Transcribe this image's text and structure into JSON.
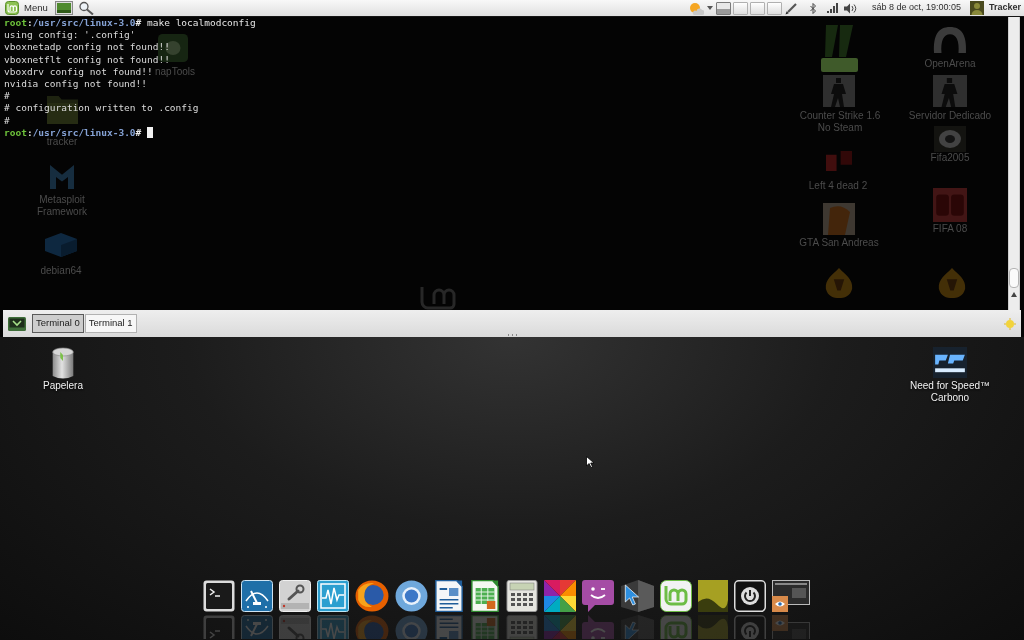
{
  "top_panel": {
    "menu": {
      "label": "Menu"
    },
    "workspaces": [
      {
        "selected": true
      },
      {
        "selected": false
      },
      {
        "selected": false
      },
      {
        "selected": false
      }
    ],
    "clock": "sáb 8 de oct, 19:00:05",
    "user": "Tracker"
  },
  "terminal": {
    "lines": [
      {
        "kind": "prompt",
        "user": "root",
        "separator": ":",
        "path": "/usr/src/linux-3.0",
        "symbol": "#",
        "command": "make localmodconfig"
      },
      {
        "kind": "output",
        "text": "using config: '.config'"
      },
      {
        "kind": "output",
        "text": "vboxnetadp config not found!!"
      },
      {
        "kind": "output",
        "text": "vboxnetflt config not found!!"
      },
      {
        "kind": "output",
        "text": "vboxdrv config not found!!"
      },
      {
        "kind": "output",
        "text": "nvidia config not found!!"
      },
      {
        "kind": "output",
        "text": "#"
      },
      {
        "kind": "output",
        "text": "# configuration written to .config"
      },
      {
        "kind": "output",
        "text": "#"
      },
      {
        "kind": "prompt",
        "user": "root",
        "separator": ":",
        "path": "/usr/src/linux-3.0",
        "symbol": "#"
      }
    ],
    "cursor": true,
    "tabs": [
      {
        "label": "Terminal 0",
        "selected": true
      },
      {
        "label": "Terminal 1",
        "selected": false
      }
    ]
  },
  "desktop": {
    "behind_terminal": [
      {
        "kind": "tile",
        "label_lines": [
          "napTools"
        ],
        "selected": false
      },
      {
        "kind": "folder",
        "label_lines": [
          "tracker"
        ],
        "selected": false
      },
      {
        "kind": "mlogo",
        "label_lines": [
          "Metasploit",
          "Framework"
        ],
        "selected": false
      },
      {
        "kind": "cube",
        "label_lines": [
          "debian64"
        ],
        "selected": false
      },
      {
        "kind": "claw",
        "selected": true
      },
      {
        "kind": "soldier",
        "label_lines": [
          "Counter Strike 1.6",
          "No Steam"
        ],
        "selected": false
      },
      {
        "kind": "digits",
        "label_lines": [
          "Left 4 dead 2"
        ],
        "selected": false
      },
      {
        "kind": "portrait",
        "label_lines": [
          "GTA San Andreas"
        ],
        "selected": false
      },
      {
        "kind": "flame",
        "selected": false
      },
      {
        "kind": "arena",
        "label_lines": [
          "OpenArena"
        ],
        "selected": false
      },
      {
        "kind": "soldier",
        "label_lines": [
          "Servidor Dedicado"
        ],
        "selected": false
      },
      {
        "kind": "crest",
        "label_lines": [
          "Fifa2005"
        ],
        "selected": false
      },
      {
        "kind": "poster",
        "label_lines": [
          "FIFA 08"
        ],
        "selected": false
      },
      {
        "kind": "flame",
        "selected": false
      }
    ],
    "icons": [
      {
        "kind": "trash",
        "label_lines": [
          "Papelera"
        ],
        "selected": false
      },
      {
        "kind": "racing",
        "label_lines": [
          "Need for Speed™",
          "Carbono"
        ],
        "selected": false
      }
    ]
  },
  "dock": {
    "launchers": [
      {
        "kind": "terminal"
      },
      {
        "kind": "wiper"
      },
      {
        "kind": "wrench"
      },
      {
        "kind": "waveform"
      },
      {
        "kind": "foxglobe"
      },
      {
        "kind": "orb"
      },
      {
        "kind": "document"
      },
      {
        "kind": "spreadsheet"
      },
      {
        "kind": "calculator"
      },
      {
        "kind": "colorwheel"
      },
      {
        "kind": "chat"
      },
      {
        "kind": "cursorcube"
      },
      {
        "kind": "logo"
      },
      {
        "kind": "photo"
      },
      {
        "kind": "power"
      },
      {
        "kind": "screen"
      }
    ]
  }
}
